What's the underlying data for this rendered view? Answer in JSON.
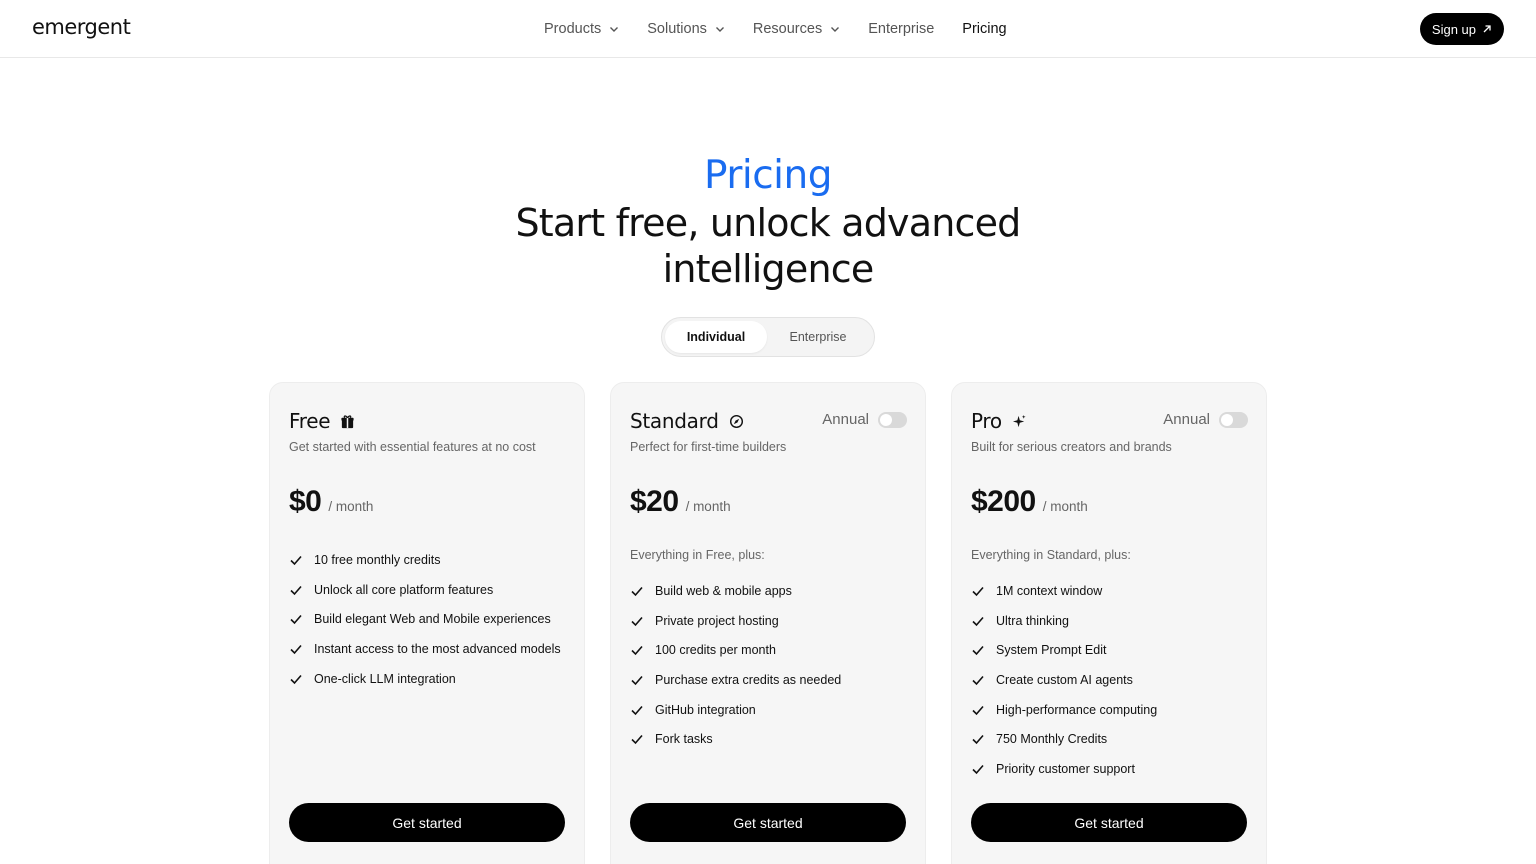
{
  "header": {
    "logo": "emergent",
    "nav": [
      {
        "label": "Products",
        "dropdown": true
      },
      {
        "label": "Solutions",
        "dropdown": true
      },
      {
        "label": "Resources",
        "dropdown": true
      },
      {
        "label": "Enterprise",
        "dropdown": false
      },
      {
        "label": "Pricing",
        "dropdown": false,
        "active": true
      }
    ],
    "signup_label": "Sign up",
    "signup_icon": "arrow-up-right-icon"
  },
  "hero": {
    "eyebrow": "Pricing",
    "headline": "Start free, unlock advanced intelligence",
    "accent_color": "#1a6cf0"
  },
  "toggle": {
    "options": [
      "Individual",
      "Enterprise"
    ],
    "selected": "Individual"
  },
  "plans": [
    {
      "name": "Free",
      "icon": "gift-icon",
      "description": "Get started with essential features at no cost",
      "price": "$0",
      "period": "/ month",
      "annual_toggle": null,
      "lead": "",
      "features": [
        "10 free monthly credits",
        "Unlock all core platform features",
        "Build elegant Web and Mobile experiences",
        "Instant access to the most advanced models",
        "One-click LLM integration"
      ],
      "cta": "Get started"
    },
    {
      "name": "Standard",
      "icon": "compass-icon",
      "description": "Perfect for first-time builders",
      "price": "$20",
      "period": "/ month",
      "annual_label": "Annual",
      "annual_on": false,
      "lead": "Everything in Free, plus:",
      "features": [
        "Build web & mobile apps",
        "Private project hosting",
        "100 credits per month",
        "Purchase extra credits as needed",
        "GitHub integration",
        "Fork tasks"
      ],
      "cta": "Get started"
    },
    {
      "name": "Pro",
      "icon": "sparkle-icon",
      "description": "Built for serious creators and brands",
      "price": "$200",
      "period": "/ month",
      "annual_label": "Annual",
      "annual_on": false,
      "lead": "Everything in Standard, plus:",
      "features": [
        "1M context window",
        "Ultra thinking",
        "System Prompt Edit",
        "Create custom AI agents",
        "High-performance computing",
        "750 Monthly Credits",
        "Priority customer support"
      ],
      "cta": "Get started"
    }
  ]
}
